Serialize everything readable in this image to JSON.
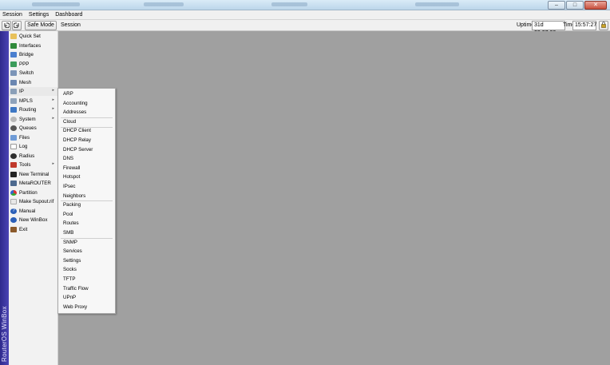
{
  "menubar": {
    "items": [
      "Session",
      "Settings",
      "Dashboard"
    ]
  },
  "toolbar": {
    "undo_icon": "undo-icon",
    "redo_icon": "redo-icon",
    "safe_mode_label": "Safe Mode",
    "session_label": "Session",
    "uptime_label": "Uptime:",
    "uptime_value": "31d 23:27:20",
    "time_label": "Time:",
    "time_value": "15:57:27",
    "lock_icon": "lock-icon"
  },
  "window_controls": {
    "minimize": "–",
    "maximize": "□",
    "close": "✕"
  },
  "brand": {
    "vertical_label": "RouterOS WinBox"
  },
  "sidebar": {
    "items": [
      {
        "label": "Quick Set",
        "icon": "quick-set-icon",
        "has_submenu": false
      },
      {
        "label": "Interfaces",
        "icon": "interfaces-icon",
        "has_submenu": false
      },
      {
        "label": "Bridge",
        "icon": "bridge-icon",
        "has_submenu": false
      },
      {
        "label": "PPP",
        "icon": "ppp-icon",
        "has_submenu": false
      },
      {
        "label": "Switch",
        "icon": "switch-icon",
        "has_submenu": false
      },
      {
        "label": "Mesh",
        "icon": "mesh-icon",
        "has_submenu": false
      },
      {
        "label": "IP",
        "icon": "ip-icon",
        "has_submenu": true
      },
      {
        "label": "MPLS",
        "icon": "mpls-icon",
        "has_submenu": true
      },
      {
        "label": "Routing",
        "icon": "routing-icon",
        "has_submenu": true
      },
      {
        "label": "System",
        "icon": "system-icon",
        "has_submenu": true
      },
      {
        "label": "Queues",
        "icon": "queues-icon",
        "has_submenu": false
      },
      {
        "label": "Files",
        "icon": "files-icon",
        "has_submenu": false
      },
      {
        "label": "Log",
        "icon": "log-icon",
        "has_submenu": false
      },
      {
        "label": "Radius",
        "icon": "radius-icon",
        "has_submenu": false
      },
      {
        "label": "Tools",
        "icon": "tools-icon",
        "has_submenu": true
      },
      {
        "label": "New Terminal",
        "icon": "terminal-icon",
        "has_submenu": false
      },
      {
        "label": "MetaROUTER",
        "icon": "metarouter-icon",
        "has_submenu": false
      },
      {
        "label": "Partition",
        "icon": "partition-icon",
        "has_submenu": false
      },
      {
        "label": "Make Supout.rif",
        "icon": "supout-icon",
        "has_submenu": false
      },
      {
        "label": "Manual",
        "icon": "manual-icon",
        "has_submenu": false
      },
      {
        "label": "New WinBox",
        "icon": "winbox-icon",
        "has_submenu": false
      },
      {
        "label": "Exit",
        "icon": "exit-icon",
        "has_submenu": false
      }
    ]
  },
  "submenu": {
    "parent": "IP",
    "items": [
      "ARP",
      "Accounting",
      "Addresses",
      "Cloud",
      "DHCP Client",
      "DHCP Relay",
      "DHCP Server",
      "DNS",
      "Firewall",
      "Hotspot",
      "IPsec",
      "Neighbors",
      "Packing",
      "Pool",
      "Routes",
      "SMB",
      "SNMP",
      "Services",
      "Settings",
      "Socks",
      "TFTP",
      "Traffic Flow",
      "UPnP",
      "Web Proxy"
    ]
  },
  "colors": {
    "workspace": "#a0a0a0",
    "brand_strip": "#3a34a0",
    "menu_bg": "#f0f0f0"
  }
}
